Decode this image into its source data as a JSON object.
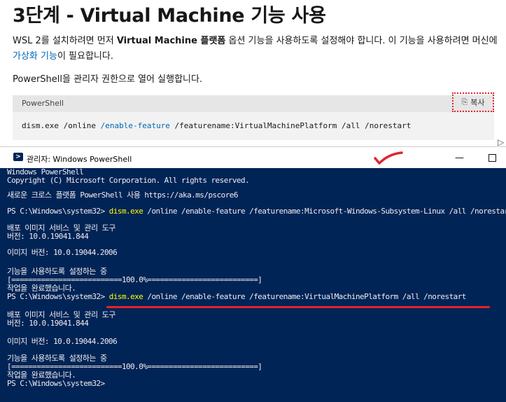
{
  "doc": {
    "title": "3단계 - Virtual Machine 기능 사용",
    "para_line1_pre": "WSL 2를 설치하려면 먼저 ",
    "para_line1_bold": "Virtual Machine 플랫폼",
    "para_line1_post": " 옵션 기능을 사용하도록 설정해야 합니다. 이 기능을 사용하려면 머신에",
    "para_line2_link": "가상화 기능",
    "para_line2_post": "이 필요합니다.",
    "para2": "PowerShell을 관리자 권한으로 열어 실행합니다."
  },
  "codeblock": {
    "language": "PowerShell",
    "copy_label": "복사",
    "copy_icon": "copy-icon",
    "cmd": "dism.exe /online ",
    "param_enable": "/enable-feature",
    "cmd_rest": " /featurename:VirtualMachinePlatform /all /norestart"
  },
  "window": {
    "title": "관리자: Windows PowerShell",
    "minimize": "—",
    "icon": "powershell-icon"
  },
  "console": {
    "lines": [
      {
        "text": "Windows PowerShell"
      },
      {
        "text": "Copyright (C) Microsoft Corporation. All rights reserved."
      },
      {
        "text": "새로운 크로스 플랫폼 PowerShell 사용 https://aka.ms/pscore6"
      },
      {
        "prompt": "PS C:\\Windows\\system32> ",
        "cmd": "dism.exe",
        "rest": " /online /enable-feature /featurename:Microsoft-Windows-Subsystem-Linux /all /norestart"
      },
      {
        "text": "배포 이미지 서비스 및 관리 도구"
      },
      {
        "text": "버전: 10.0.19041.844"
      },
      {
        "text": "이미지 버전: 10.0.19044.2006"
      },
      {
        "text": "기능을 사용하도록 설정하는 중"
      },
      {
        "text": "[==========================100.0%==========================]"
      },
      {
        "text": "작업을 완료했습니다."
      },
      {
        "prompt": "PS C:\\Windows\\system32> ",
        "cmd": "dism.exe",
        "rest": " /online /enable-feature /featurename:VirtualMachinePlatform /all /norestart"
      },
      {
        "text": "배포 이미지 서비스 및 관리 도구"
      },
      {
        "text": "버전: 10.0.19041.844"
      },
      {
        "text": "이미지 버전: 10.0.19044.2006"
      },
      {
        "text": "기능을 사용하도록 설정하는 중"
      },
      {
        "text": "[==========================100.0%==========================]"
      },
      {
        "text": "작업을 완료했습니다."
      },
      {
        "text": "PS C:\\Windows\\system32>"
      }
    ]
  },
  "colors": {
    "console_bg": "#012456",
    "console_text": "#eeedf0",
    "console_cmd": "#ffff00",
    "annotation_red": "#e3242b",
    "link_blue": "#0065b3"
  }
}
